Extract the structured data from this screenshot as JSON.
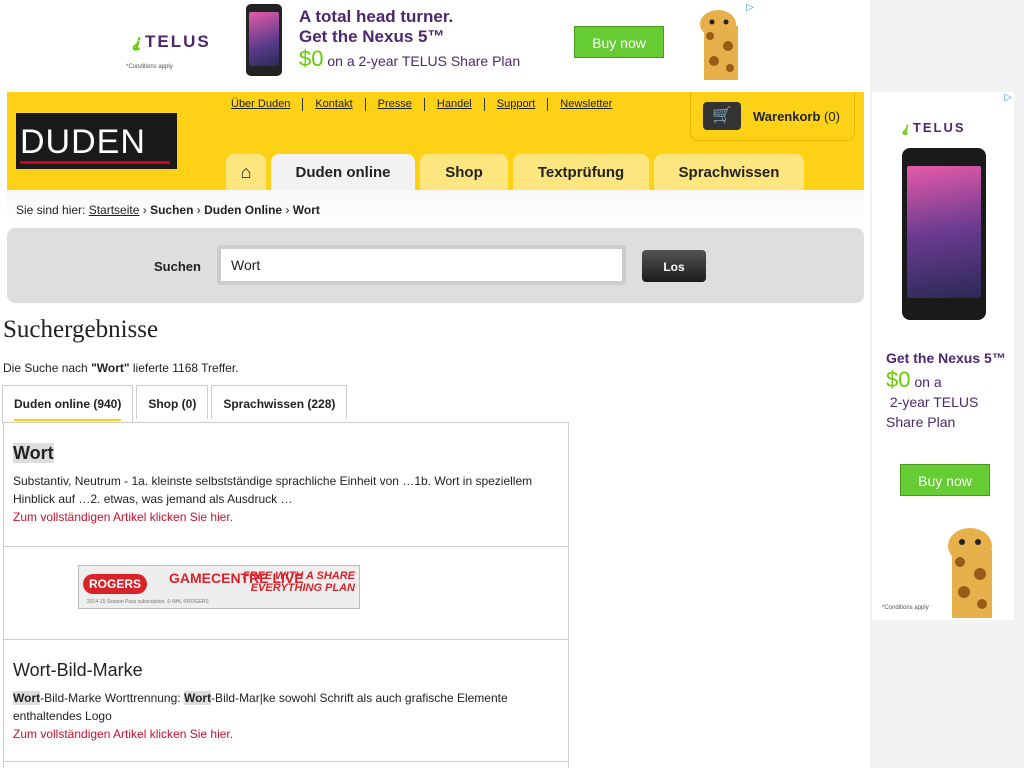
{
  "top_ad": {
    "brand": "TELUS",
    "headline_1": "A total head turner.",
    "headline_2": "Get the Nexus 5™",
    "offer_price": "$0",
    "offer_text": " on a 2-year TELUS Share Plan",
    "cta": "Buy now",
    "conditions": "*Conditions apply"
  },
  "side_ad": {
    "brand": "TELUS",
    "headline": "Get the Nexus 5™",
    "offer_price": "$0",
    "offer_text_1": " on a",
    "offer_text_2": "2-year TELUS",
    "offer_text_3": "Share Plan",
    "cta": "Buy now",
    "conditions": "*Conditions apply"
  },
  "header": {
    "logo": "DUDEN",
    "top_links": [
      "Über Duden",
      "Kontakt",
      "Presse",
      "Handel",
      "Support",
      "Newsletter"
    ],
    "cart_label": "Warenkorb",
    "cart_count": "(0)",
    "nav": [
      "Duden online",
      "Shop",
      "Textprüfung",
      "Sprachwissen"
    ]
  },
  "breadcrumb": {
    "prefix": "Sie sind hier:",
    "home": "Startseite",
    "items": [
      "Suchen",
      "Duden Online",
      "Wort"
    ]
  },
  "search": {
    "label": "Suchen",
    "value": "Wort",
    "button": "Los"
  },
  "results": {
    "title": "Suchergebnisse",
    "summary_prefix": "Die Suche nach ",
    "query": "\"Wort\"",
    "summary_suffix": " lieferte 1168 Treffer.",
    "tabs": [
      "Duden online (940)",
      "Shop (0)",
      "Sprachwissen (228)"
    ],
    "items": [
      {
        "title": "Wort",
        "desc": "Substantiv, Neutrum - 1a. kleinste selbstständige sprachliche Einheit von …1b. Wort in speziellem Hinblick auf …2. etwas, was jemand als Ausdruck …",
        "link": "Zum vollständigen Artikel klicken Sie hier."
      },
      {
        "title": "Wort-Bild-Marke",
        "desc_hl_1": "Wort",
        "desc_mid": "-Bild-Marke Worttrennung: ",
        "desc_hl_2": "Wort",
        "desc_end": "-Bild-Mar|ke sowohl Schrift als auch grafische Elemente enthaltendes Logo",
        "link": "Zum vollständigen Artikel klicken Sie hier."
      }
    ]
  },
  "rogers_ad": {
    "brand": "ROGERS",
    "product": "GAMECENTRE LIVE",
    "promo": "FREE WITH A SHARE EVERYTHING PLAN",
    "fine": "2014-15 Season Pass subscription. © NHL ©ROGERS"
  },
  "colors": {
    "duden_yellow": "#fcd116",
    "link_red": "#c8102e",
    "telus_purple": "#4b286d",
    "telus_green": "#66cc33"
  }
}
